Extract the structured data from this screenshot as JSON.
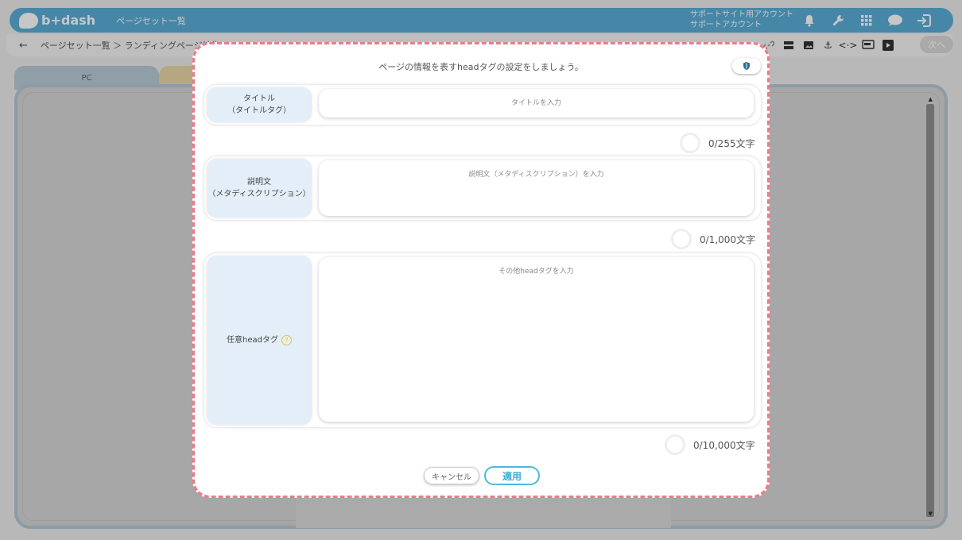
{
  "app": {
    "logo_text": "b+dash",
    "page_title": "ページセット一覧",
    "account_line1": "サポートサイト用アカウント",
    "account_line2": "サポートアカウント"
  },
  "header_icons": [
    "bell-icon",
    "wrench-icon",
    "grid-icon",
    "chat-icon",
    "logout-icon"
  ],
  "toolbar": {
    "breadcrumb": "ページセット一覧 ＞ ランディングページ編集",
    "next_label": "次へ",
    "icons": [
      "link-icon",
      "layout-icon",
      "image-icon",
      "anchor-icon",
      "code-icon",
      "device-icon",
      "play-icon"
    ]
  },
  "canvas": {
    "tab_pc": "PC"
  },
  "modal": {
    "intro": "ページの情報を表すheadタグの設定をしましょう。",
    "fields": {
      "title": {
        "label_line1": "タイトル",
        "label_line2": "（タイトルタグ）",
        "placeholder": "タイトルを入力",
        "count": "0/255文字"
      },
      "description": {
        "label_line1": "説明文",
        "label_line2": "（メタディスクリプション）",
        "placeholder": "説明文（メタディスクリプション）を入力",
        "count": "0/1,000文字"
      },
      "head_tag": {
        "label": "任意headタグ",
        "help": "?",
        "placeholder": "その他headタグを入力",
        "count": "0/10,000文字"
      }
    },
    "cancel_label": "キャンセル",
    "apply_label": "適用"
  },
  "colors": {
    "header": "#5aaed8",
    "modal_border": "#f07a88",
    "label_bg": "#e3eef8",
    "apply": "#3aaed6",
    "help": "#e8c238"
  }
}
